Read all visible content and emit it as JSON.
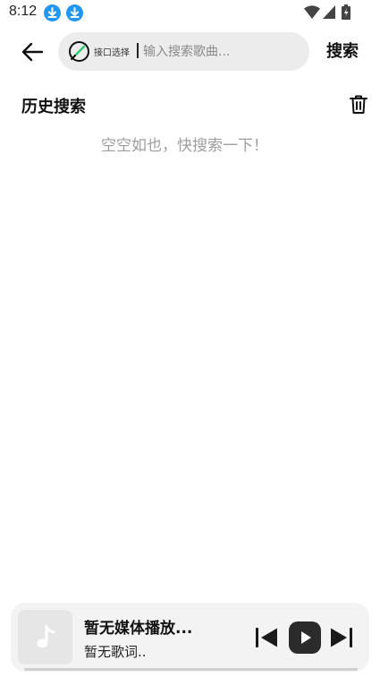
{
  "status_bar": {
    "time": "8:12",
    "icons": [
      "download-icon",
      "download-icon",
      "wifi-icon",
      "signal-icon",
      "battery-icon"
    ]
  },
  "header": {
    "back_icon": "arrow-left-icon",
    "api_icon": "link-icon",
    "api_label": "接口选择",
    "search_placeholder": "输入搜索歌曲...",
    "search_value": "",
    "search_button": "搜索"
  },
  "history": {
    "title": "历史搜索",
    "clear_icon": "trash-icon",
    "empty_text": "空空如也，快搜索一下！"
  },
  "player": {
    "cover_icon": "music-note-icon",
    "title": "暂无媒体播放...",
    "lyric": "暂无歌词..",
    "controls": [
      "skip-previous-icon",
      "play-icon",
      "skip-next-icon"
    ]
  },
  "colors": {
    "accent": "#2196f3",
    "api_icon_green": "#2ecc71",
    "search_bg": "#ececec",
    "player_bg": "#f3f3f3",
    "empty_text": "#9e9e9e"
  }
}
